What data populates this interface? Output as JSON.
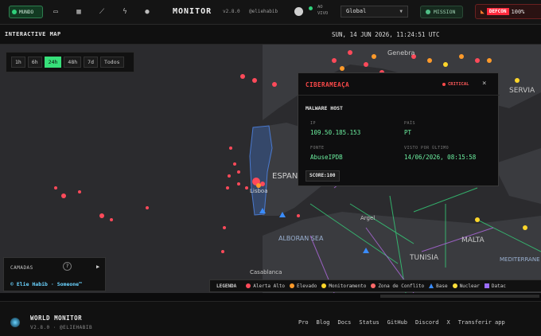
{
  "header": {
    "view_label": "MUNDO",
    "title": "MONITOR",
    "version": "v2.8.0",
    "user": "@eliehabib",
    "live_label": "AO VIVO",
    "region_select": "Global",
    "mission_label": "MISSION",
    "defcon_label": "DEFCON",
    "defcon_pct": "100%",
    "icons": [
      "monitor-icon",
      "chart-icon",
      "wrench-icon",
      "lightning-icon",
      "sun-icon",
      "github-icon"
    ]
  },
  "subheader": {
    "section_title": "INTERACTIVE MAP",
    "datetime": "SUN, 14 JUN 2026, 11:24:51 UTC"
  },
  "time_filters": {
    "options": [
      "1h",
      "6h",
      "24h",
      "48h",
      "7d",
      "Todos"
    ],
    "selected": "24h"
  },
  "map_labels": [
    "Genebra",
    "ESPANA",
    "Lisboa",
    "Argel",
    "ALBORAN SEA",
    "MALTA",
    "TUNISIA",
    "MEDITERRANE",
    "SERVIA",
    "Casablanca"
  ],
  "popup": {
    "title": "CIBERAMEAÇA",
    "severity": "CRITICAL",
    "subtitle": "MALWARE HOST",
    "ip_label": "IP",
    "ip_value": "109.50.185.153",
    "country_label": "PAÍS",
    "country_value": "PT",
    "source_label": "FONTE",
    "source_value": "AbuseIPDB",
    "last_seen_label": "VISTO POR ÚLTIMO",
    "last_seen_value": "14/06/2026, 08:15:58",
    "score_label": "SCORE:100"
  },
  "layers_panel": {
    "title": "CAMADAS",
    "help": "?",
    "credit": "© Elie Habib · Someone™"
  },
  "legend": {
    "title": "LEGENDA",
    "items": [
      {
        "label": "Alerta Alto",
        "color": "#ff4a5a",
        "shape": "circle"
      },
      {
        "label": "Elevado",
        "color": "#ff9a2a",
        "shape": "circle"
      },
      {
        "label": "Monitoramento",
        "color": "#ffd62a",
        "shape": "circle"
      },
      {
        "label": "Zona de Conflito",
        "color": "#ff6a6a",
        "shape": "circle"
      },
      {
        "label": "Base",
        "color": "#3a8cff",
        "shape": "triangle"
      },
      {
        "label": "Nuclear",
        "color": "#ffdf3a",
        "shape": "circle"
      },
      {
        "label": "Datac",
        "color": "#9a6cff",
        "shape": "square"
      }
    ]
  },
  "footer": {
    "name": "WORLD MONITOR",
    "version": "V2.8.0 · @ELIEHABIB",
    "links": [
      "Pro",
      "Blog",
      "Docs",
      "Status",
      "GitHub",
      "Discord",
      "X",
      "Transferir app"
    ]
  }
}
